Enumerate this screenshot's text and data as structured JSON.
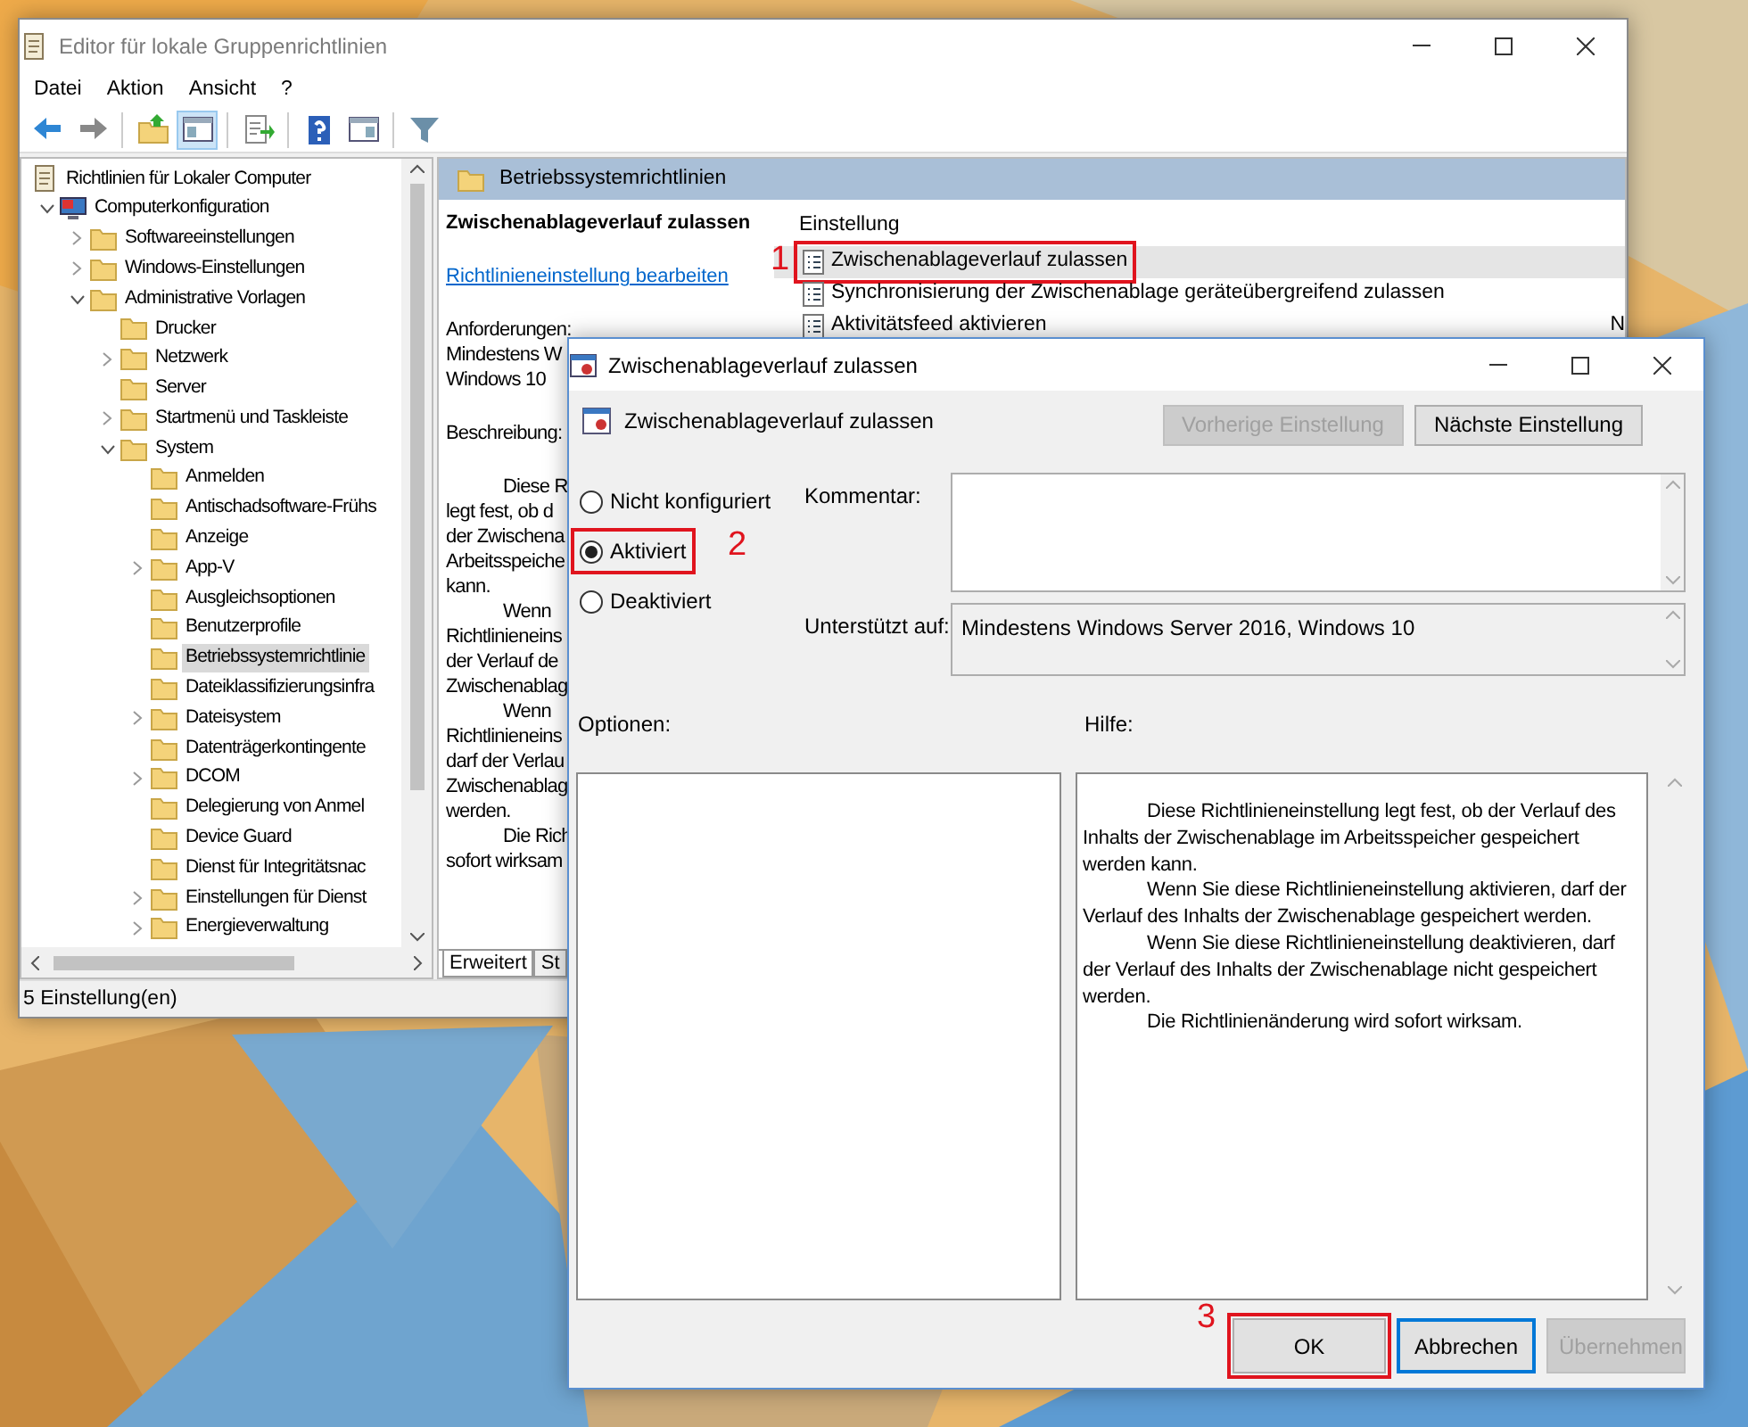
{
  "main_window": {
    "title": "Editor für lokale Gruppenrichtlinien",
    "menu": [
      "Datei",
      "Aktion",
      "Ansicht",
      "?"
    ],
    "toolbar": [
      {
        "kind": "back",
        "pressed": false
      },
      {
        "kind": "forward",
        "pressed": false
      },
      {
        "kind": "sep"
      },
      {
        "kind": "folder-up",
        "pressed": false
      },
      {
        "kind": "tree",
        "pressed": true
      },
      {
        "kind": "sep"
      },
      {
        "kind": "export",
        "pressed": false
      },
      {
        "kind": "sep"
      },
      {
        "kind": "help",
        "pressed": false
      },
      {
        "kind": "panel",
        "pressed": false
      },
      {
        "kind": "sep"
      },
      {
        "kind": "filter",
        "pressed": false
      }
    ],
    "tree": [
      {
        "label": "Richtlinien für Lokaler Computer",
        "kind": "policy",
        "selected": false,
        "children": [
          {
            "label": "Computerkonfiguration",
            "kind": "computer",
            "expanded": true,
            "selected": false,
            "children": [
              {
                "label": "Softwareeinstellungen",
                "kind": "folder",
                "expanded": false,
                "selected": false
              },
              {
                "label": "Windows-Einstellungen",
                "kind": "folder",
                "expanded": false,
                "selected": false
              },
              {
                "label": "Administrative Vorlagen",
                "kind": "folder",
                "expanded": true,
                "selected": false,
                "children": [
                  {
                    "label": "Drucker",
                    "kind": "folder",
                    "selected": false
                  },
                  {
                    "label": "Netzwerk",
                    "kind": "folder",
                    "expanded": false,
                    "selected": false
                  },
                  {
                    "label": "Server",
                    "kind": "folder",
                    "selected": false
                  },
                  {
                    "label": "Startmenü und Taskleiste",
                    "kind": "folder",
                    "expanded": false,
                    "selected": false
                  },
                  {
                    "label": "System",
                    "kind": "folder",
                    "expanded": true,
                    "selected": false,
                    "children": [
                      {
                        "label": "Anmelden",
                        "kind": "folder",
                        "selected": false
                      },
                      {
                        "label": "Antischadsoftware-Frühs",
                        "kind": "folder",
                        "selected": false
                      },
                      {
                        "label": "Anzeige",
                        "kind": "folder",
                        "selected": false
                      },
                      {
                        "label": "App-V",
                        "kind": "folder",
                        "expanded": false,
                        "selected": false
                      },
                      {
                        "label": "Ausgleichsoptionen",
                        "kind": "folder",
                        "selected": false
                      },
                      {
                        "label": "Benutzerprofile",
                        "kind": "folder",
                        "selected": false
                      },
                      {
                        "label": "Betriebssystemrichtlinie",
                        "kind": "folder",
                        "selected": true
                      },
                      {
                        "label": "Dateiklassifizierungsinfra",
                        "kind": "folder",
                        "selected": false
                      },
                      {
                        "label": "Dateisystem",
                        "kind": "folder",
                        "expanded": false,
                        "selected": false
                      },
                      {
                        "label": "Datenträgerkontingente",
                        "kind": "folder",
                        "selected": false
                      },
                      {
                        "label": "DCOM",
                        "kind": "folder",
                        "expanded": false,
                        "selected": false
                      },
                      {
                        "label": "Delegierung von Anmel",
                        "kind": "folder",
                        "selected": false
                      },
                      {
                        "label": "Device Guard",
                        "kind": "folder",
                        "selected": false
                      },
                      {
                        "label": "Dienst für Integritätsnac",
                        "kind": "folder",
                        "selected": false
                      },
                      {
                        "label": "Einstellungen für Dienst",
                        "kind": "folder",
                        "expanded": false,
                        "selected": false
                      },
                      {
                        "label": "Energieverwaltung",
                        "kind": "folder",
                        "expanded": false,
                        "selected": false
                      }
                    ]
                  }
                ]
              }
            ]
          }
        ]
      }
    ],
    "details": {
      "header": "Betriebssystemrichtlinien",
      "policy_title": "Zwischenablageverlauf zulassen",
      "edit_link": "Richtlinieneinstellung bearbeiten",
      "requirements_label": "Anforderungen:",
      "requirements_lines": [
        "Mindestens W",
        "Windows 10"
      ],
      "description_label": "Beschreibung:",
      "description_lines": [
        {
          "text": "Diese R",
          "kind": "indented"
        },
        {
          "text": "legt fest, ob d",
          "kind": "plain"
        },
        {
          "text": "der Zwischena",
          "kind": "plain"
        },
        {
          "text": "Arbeitsspeiche",
          "kind": "plain"
        },
        {
          "text": "kann.",
          "kind": "plain"
        },
        {
          "text": "Wenn",
          "kind": "indented"
        },
        {
          "text": "Richtlinieneins",
          "kind": "plain"
        },
        {
          "text": "der Verlauf de",
          "kind": "plain"
        },
        {
          "text": "Zwischenablag",
          "kind": "plain"
        },
        {
          "text": "Wenn",
          "kind": "indented"
        },
        {
          "text": "Richtlinieneins",
          "kind": "plain"
        },
        {
          "text": "darf der Verlau",
          "kind": "plain"
        },
        {
          "text": "Zwischenablag",
          "kind": "plain"
        },
        {
          "text": "werden.",
          "kind": "plain"
        },
        {
          "text": "Die Rich",
          "kind": "indented"
        },
        {
          "text": "sofort wirksam",
          "kind": "plain"
        }
      ]
    },
    "settings_list": {
      "columns": [
        "Einstellung"
      ],
      "rows": [
        {
          "name": "Zwischenablageverlauf zulassen",
          "selected": true,
          "marker": "1"
        },
        {
          "name": "Synchronisierung der Zwischenablage geräteübergreifend zulassen",
          "selected": false
        },
        {
          "name": "Aktivitätsfeed aktivieren",
          "selected": false,
          "column_2": "N"
        }
      ]
    },
    "tabs": [
      {
        "label": "Erweitert",
        "selected": true
      },
      {
        "label": "St",
        "selected": false
      }
    ],
    "status_bar": "5 Einstellung(en)"
  },
  "dialog": {
    "title": "Zwischenablageverlauf zulassen",
    "policy_name": "Zwischenablageverlauf zulassen",
    "nav_buttons": [
      {
        "label": "Vorherige Einstellung",
        "disabled": true
      },
      {
        "label": "Nächste Einstellung",
        "disabled": false
      }
    ],
    "radios": [
      {
        "label": "Nicht konfiguriert",
        "selected": false
      },
      {
        "label": "Aktiviert",
        "selected": true,
        "marker": "2"
      },
      {
        "label": "Deaktiviert",
        "selected": false
      }
    ],
    "comment_label": "Kommentar:",
    "supported_label": "Unterstützt auf:",
    "supported_value": "Mindestens Windows Server 2016, Windows 10",
    "options_label": "Optionen:",
    "help_label": "Hilfe:",
    "help_paragraphs": [
      "Diese Richtlinieneinstellung legt fest, ob der Verlauf des Inhalts der Zwischenablage im Arbeitsspeicher gespeichert werden kann.",
      "Wenn Sie diese Richtlinieneinstellung aktivieren, darf der Verlauf des Inhalts der Zwischenablage gespeichert werden.",
      "Wenn Sie diese Richtlinieneinstellung deaktivieren, darf der Verlauf des Inhalts der Zwischenablage nicht gespeichert werden.",
      "Die Richtlinienänderung wird sofort wirksam."
    ],
    "buttons": [
      {
        "label": "OK",
        "kind": "normal",
        "disabled": false,
        "marker": "3"
      },
      {
        "label": "Abbrechen",
        "kind": "default",
        "disabled": false
      },
      {
        "label": "Übernehmen",
        "kind": "normal",
        "disabled": true
      }
    ]
  }
}
